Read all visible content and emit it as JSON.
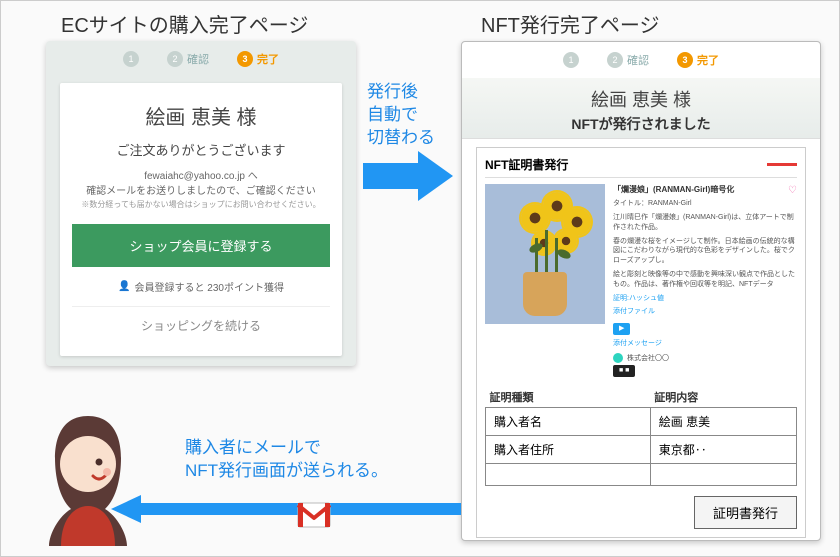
{
  "titles": {
    "left": "ECサイトの購入完了ページ",
    "right": "NFT発行完了ページ"
  },
  "steps": {
    "s1": "1",
    "s2_num": "2",
    "s2_label": "確認",
    "s3_num": "3",
    "s3_label": "完了"
  },
  "left": {
    "customer": "絵画 恵美 様",
    "thanks": "ご注文ありがとうございます",
    "email": "fewaiahc@yahoo.co.jp へ",
    "email_msg": "確認メールをお送りしましたので、ご確認ください",
    "email_note": "※数分経っても届かない場合はショップにお問い合わせください。",
    "register_btn": "ショップ会員に登録する",
    "points": "会員登録すると 230ポイント獲得",
    "continue": "ショッピングを続ける"
  },
  "annotations": {
    "switch": "発行後\n自動で\n切替わる",
    "mail": "購入者にメールで\nNFT発行画面が送られる。"
  },
  "right": {
    "customer": "絵画 恵美 様",
    "issued": "NFTが発行されました",
    "cert_heading": "NFT証明書発行",
    "artwork": {
      "title": "「爛漫娘」(RANMAN-Girl)暗号化",
      "desc1": "タイトル：RANMAN-Girl",
      "desc2": "江川晴巳作「爛漫娘」(RANMAN-Girl)は、立体アートで制作された作品。",
      "desc3": "春の爛漫な桜をイメージして制作。日本絵画の伝統的な構図にこだわりながら現代的な色彩をデザインした。桜でクローズアップし。",
      "desc4": "絵と彫刻と映像等の中で感動を興味深い観点で作品としたもの。作品は、著作権や回収等を明記、NFTデータ",
      "hash_label": "証明:ハッシュ値",
      "file_label": "添付ファイル",
      "msg_label": "添付メッセージ",
      "owner": "株式会社〇〇"
    },
    "table": {
      "h1": "証明種類",
      "h2": "証明内容",
      "r1c1": "購入者名",
      "r1c2": "絵画 恵美",
      "r2c1": "購入者住所",
      "r2c2": "東京都‥"
    },
    "issue_btn": "証明書発行"
  },
  "icons": {
    "gmail": "gmail-icon",
    "person": "person-icon",
    "arrow_right": "arrow-right-icon",
    "arrow_left": "arrow-left-icon",
    "heart": "♡"
  }
}
